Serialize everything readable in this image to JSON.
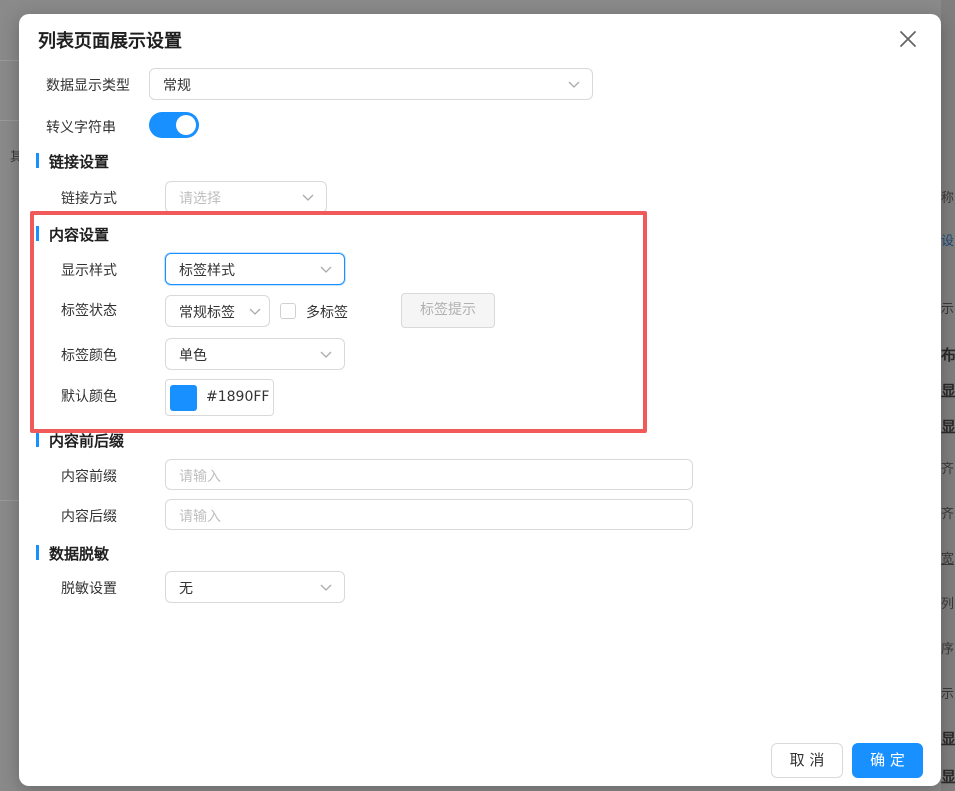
{
  "dialog": {
    "title": "列表页面展示设置",
    "close_icon": "close-icon"
  },
  "fields": {
    "data_type": {
      "label": "数据显示类型",
      "value": "常规"
    },
    "escape": {
      "label": "转义字符串",
      "on": true
    }
  },
  "link_section": {
    "title": "链接设置",
    "method": {
      "label": "链接方式",
      "placeholder": "请选择"
    }
  },
  "content_section": {
    "title": "内容设置",
    "display_style": {
      "label": "显示样式",
      "value": "标签样式"
    },
    "tag_status": {
      "label": "标签状态",
      "value": "常规标签",
      "multi_label": "多标签",
      "multi_checked": false,
      "hint_button": "标签提示"
    },
    "tag_color": {
      "label": "标签颜色",
      "value": "单色"
    },
    "default_color": {
      "label": "默认颜色",
      "hex": "#1890FF"
    }
  },
  "affix_section": {
    "title": "内容前后缀",
    "prefix": {
      "label": "内容前缀",
      "placeholder": "请输入"
    },
    "suffix": {
      "label": "内容后缀",
      "placeholder": "请输入"
    }
  },
  "mask_section": {
    "title": "数据脱敏",
    "setting": {
      "label": "脱敏设置",
      "value": "无"
    }
  },
  "footer": {
    "cancel": "取 消",
    "ok": "确 定"
  },
  "background": {
    "left_char": "其",
    "right_items": [
      "称",
      "设",
      "示",
      "布",
      "显",
      "显",
      "齐",
      "齐",
      "宽",
      "列",
      "序",
      "示",
      "显",
      "显"
    ]
  },
  "colors": {
    "primary": "#1890ff",
    "highlight": "#f05a5a"
  }
}
